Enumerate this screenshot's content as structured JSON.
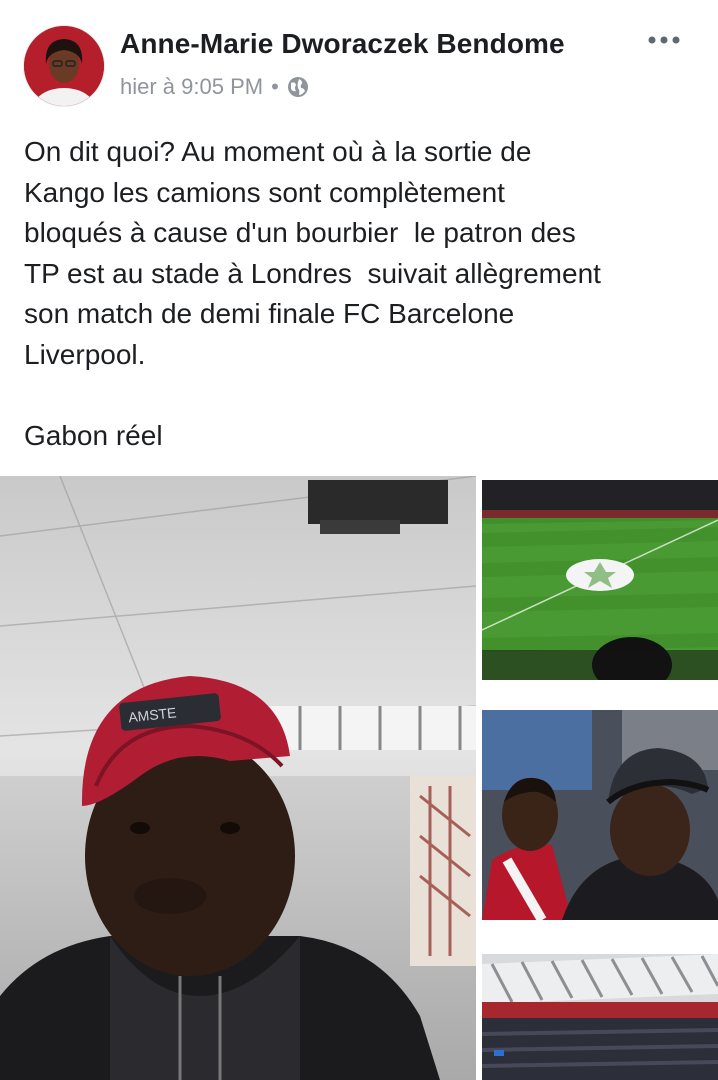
{
  "post": {
    "author": "Anne-Marie Dworaczek Bendome",
    "timestamp": "hier à 9:05 PM",
    "separator": "•",
    "audience_icon": "globe-icon",
    "more_icon": "ellipsis-icon",
    "text": "On dit quoi? Au moment où à la sortie de\nKango les camions sont complètement\nbloqués à cause d'un bourbier  le patron des\nTP est au stade à Londres  suivait allègrement\nson match de demi finale FC Barcelone\nLiverpool.\n\nGabon réel"
  },
  "photos": {
    "cap_text": "AMSTE"
  },
  "colors": {
    "author": "#1c1e21",
    "meta": "#90949c",
    "pitch": "#3f8f2c",
    "cap": "#b11e34"
  }
}
